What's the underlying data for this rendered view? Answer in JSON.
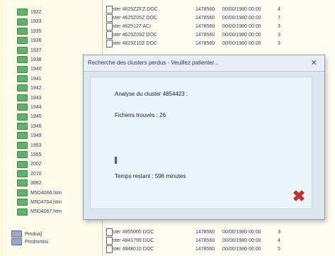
{
  "tree": {
    "items": [
      "1932",
      "1933",
      "1935",
      "1936",
      "1937",
      "1938",
      "1940",
      "1941",
      "1942",
      "1943",
      "1944",
      "1945",
      "1946",
      "1949",
      "1953",
      "1955",
      "2002",
      "2070",
      "3882",
      "M5D4066.htm",
      "M5D4704.htm",
      "M5D4067.htm"
    ],
    "bottom_items": [
      "Pmdua]",
      "Pmdmmtsi"
    ]
  },
  "file_list": {
    "top_rows": [
      {
        "name": "cluster 4625ZZFZ DOC",
        "size": "1478560",
        "date": "00/00/1980 00:00",
        "flag": "4"
      },
      {
        "name": "cluster 4625Z05Z DOC",
        "size": "1478560",
        "date": "00/00/1980 00:00",
        "flag": "7"
      },
      {
        "name": "cluster 4625127 ACI",
        "size": "1478560",
        "date": "00/00/1980 00:00",
        "flag": "3"
      },
      {
        "name": "cluster 4625Z09Z DOC",
        "size": "1478560",
        "date": "00/00/1980 00:00",
        "flag": "3"
      },
      {
        "name": "cluster 4625Z10Z DOC",
        "size": "1478560",
        "date": "00/00/1980 00:00",
        "flag": "3"
      }
    ],
    "bottom_rows": [
      {
        "name": "cluster 4855005 DOC",
        "size": "1478560",
        "date": "00/00/1980 00:00",
        "flag": "3"
      },
      {
        "name": "cluster 4841799 DOC",
        "size": "1478560",
        "date": "00/00/1980 00:00",
        "flag": "4"
      },
      {
        "name": "cluster 4848010 DOC",
        "size": "1478560",
        "date": "00/00/1980 00:00",
        "flag": "5"
      }
    ]
  },
  "dialog": {
    "title": "Recherche des clusters perdus - Veuillez patienter...",
    "close": "✕",
    "analysis": "Analyse du cluster 4854423 :",
    "files_found": "Fichiers trouvés : 26",
    "clusters_remaining": "Temps restant : 596 minutes",
    "progress_percent": 1.5,
    "cancel_icon": "cancel-x"
  }
}
